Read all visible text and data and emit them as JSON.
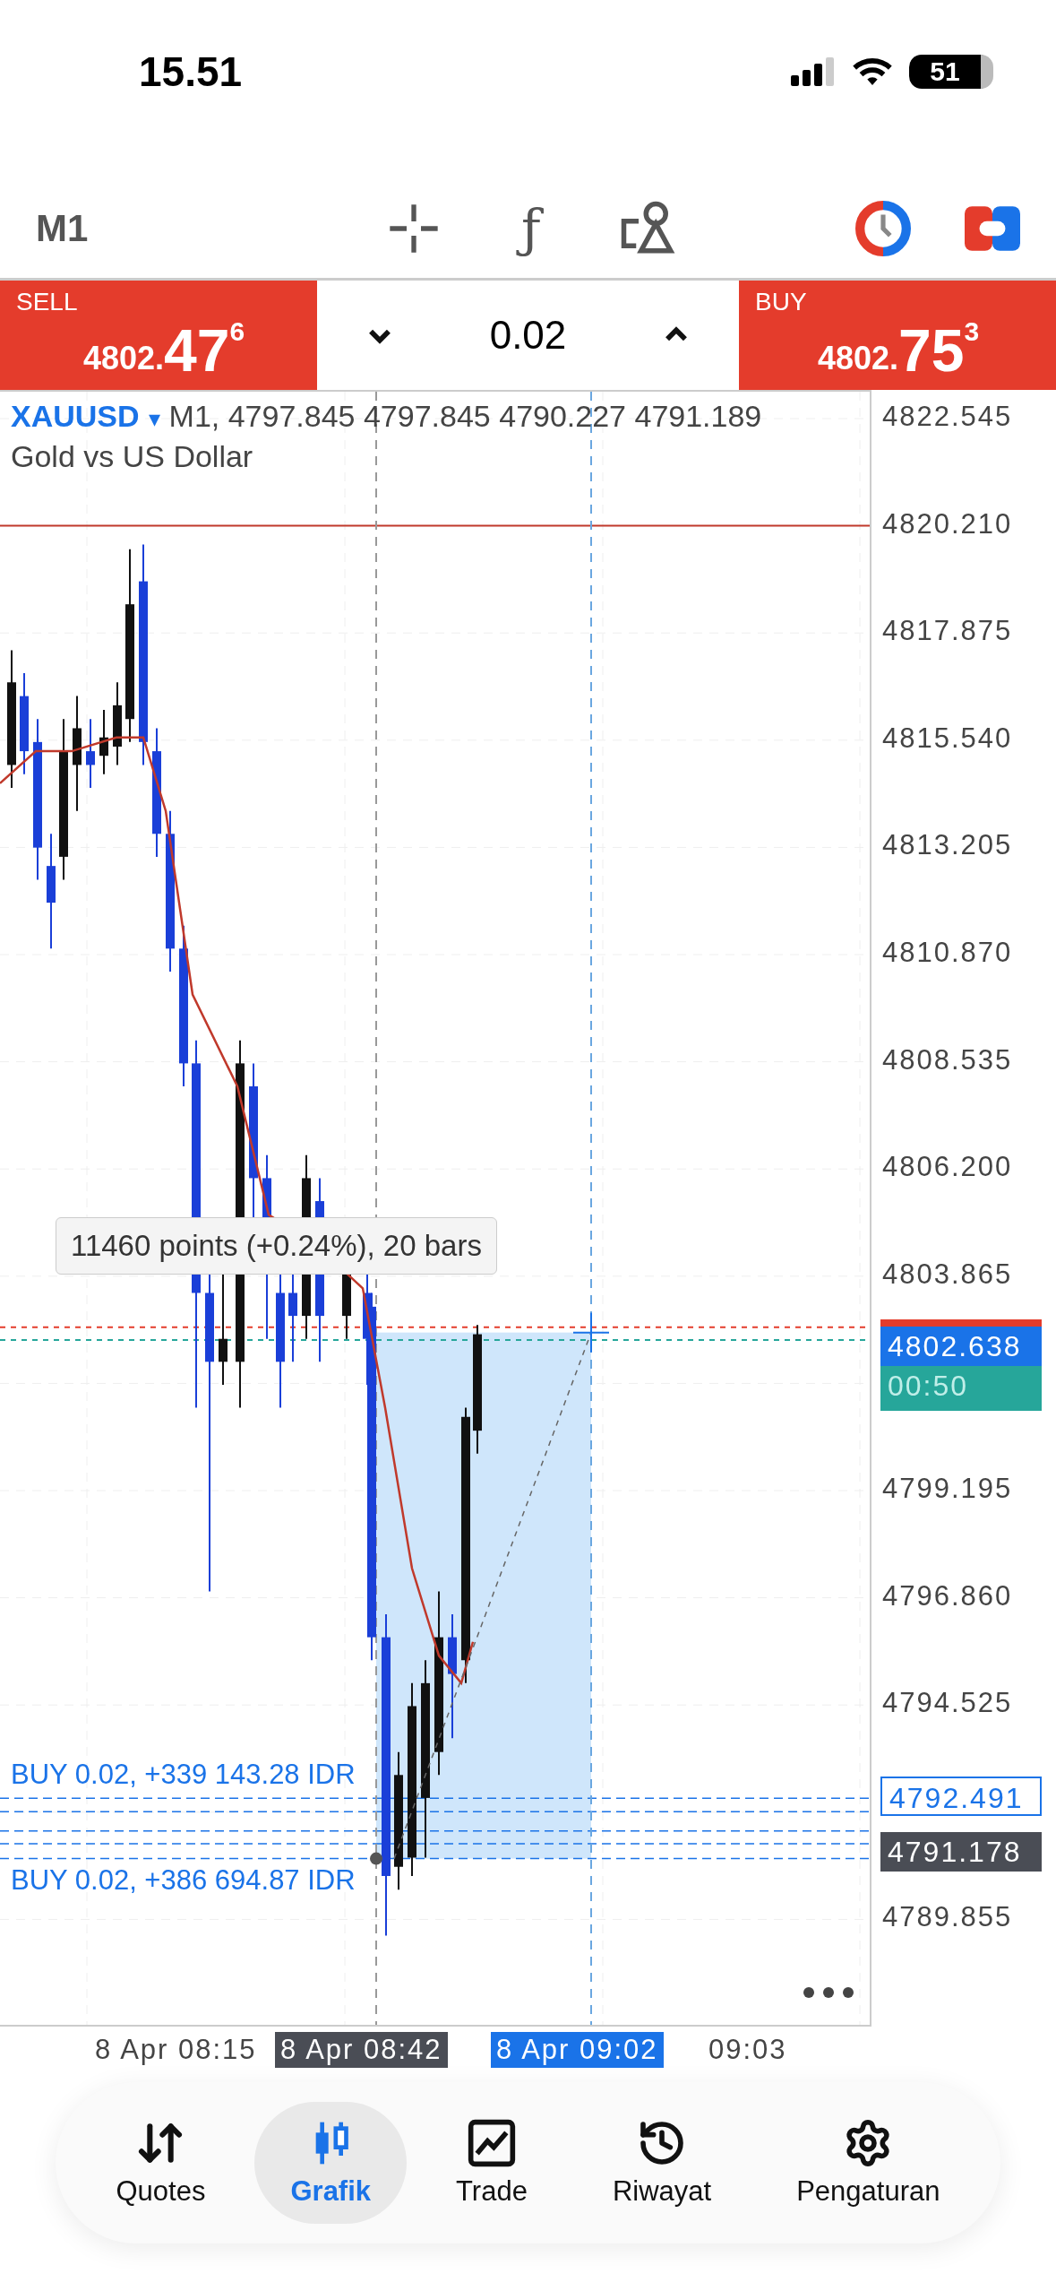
{
  "status_bar": {
    "time": "15.51",
    "battery": "51"
  },
  "toolbar": {
    "timeframe": "M1",
    "indicator_glyph": "ƒ"
  },
  "trade_bar": {
    "sell": {
      "label": "SELL",
      "price_main": "4802.",
      "price_big": "47",
      "price_sup": "6"
    },
    "volume": "0.02",
    "buy": {
      "label": "BUY",
      "price_main": "4802.",
      "price_big": "75",
      "price_sup": "3"
    }
  },
  "chart": {
    "symbol": "XAUUSD",
    "dropdown": "▾",
    "ohlc": "M1, 4797.845 4797.845 4790.227 4791.189",
    "description": "Gold vs US Dollar",
    "measure_tooltip": "11460 points (+0.24%), 20 bars",
    "positions": [
      {
        "label": "BUY 0.02, +339 143.28 IDR"
      },
      {
        "label": "BUY 0.02, +386 694.87 IDR"
      }
    ],
    "price_axis": [
      "4822.545",
      "4820.210",
      "4817.875",
      "4815.540",
      "4813.205",
      "4810.870",
      "4808.535",
      "4806.200",
      "4803.865",
      "4799.195",
      "4796.860",
      "4794.525",
      "4789.855"
    ],
    "price_tags": [
      {
        "kind": "bid",
        "text": "4802.638"
      },
      {
        "kind": "timer",
        "text": "00:50"
      },
      {
        "kind": "position",
        "text": "4792.491"
      },
      {
        "kind": "last",
        "text": "4791.178"
      }
    ],
    "time_axis": [
      {
        "kind": "plain",
        "text": "8 Apr 08:15"
      },
      {
        "kind": "cursor",
        "text": "8 Apr 08:42"
      },
      {
        "kind": "crosshair",
        "text": "8 Apr 09:02"
      },
      {
        "kind": "plain",
        "text": "09:03"
      }
    ]
  },
  "nav": [
    {
      "label": "Quotes",
      "selected": false
    },
    {
      "label": "Grafik",
      "selected": true
    },
    {
      "label": "Trade",
      "selected": false
    },
    {
      "label": "Riwayat",
      "selected": false
    },
    {
      "label": "Pengaturan",
      "selected": false
    }
  ]
}
